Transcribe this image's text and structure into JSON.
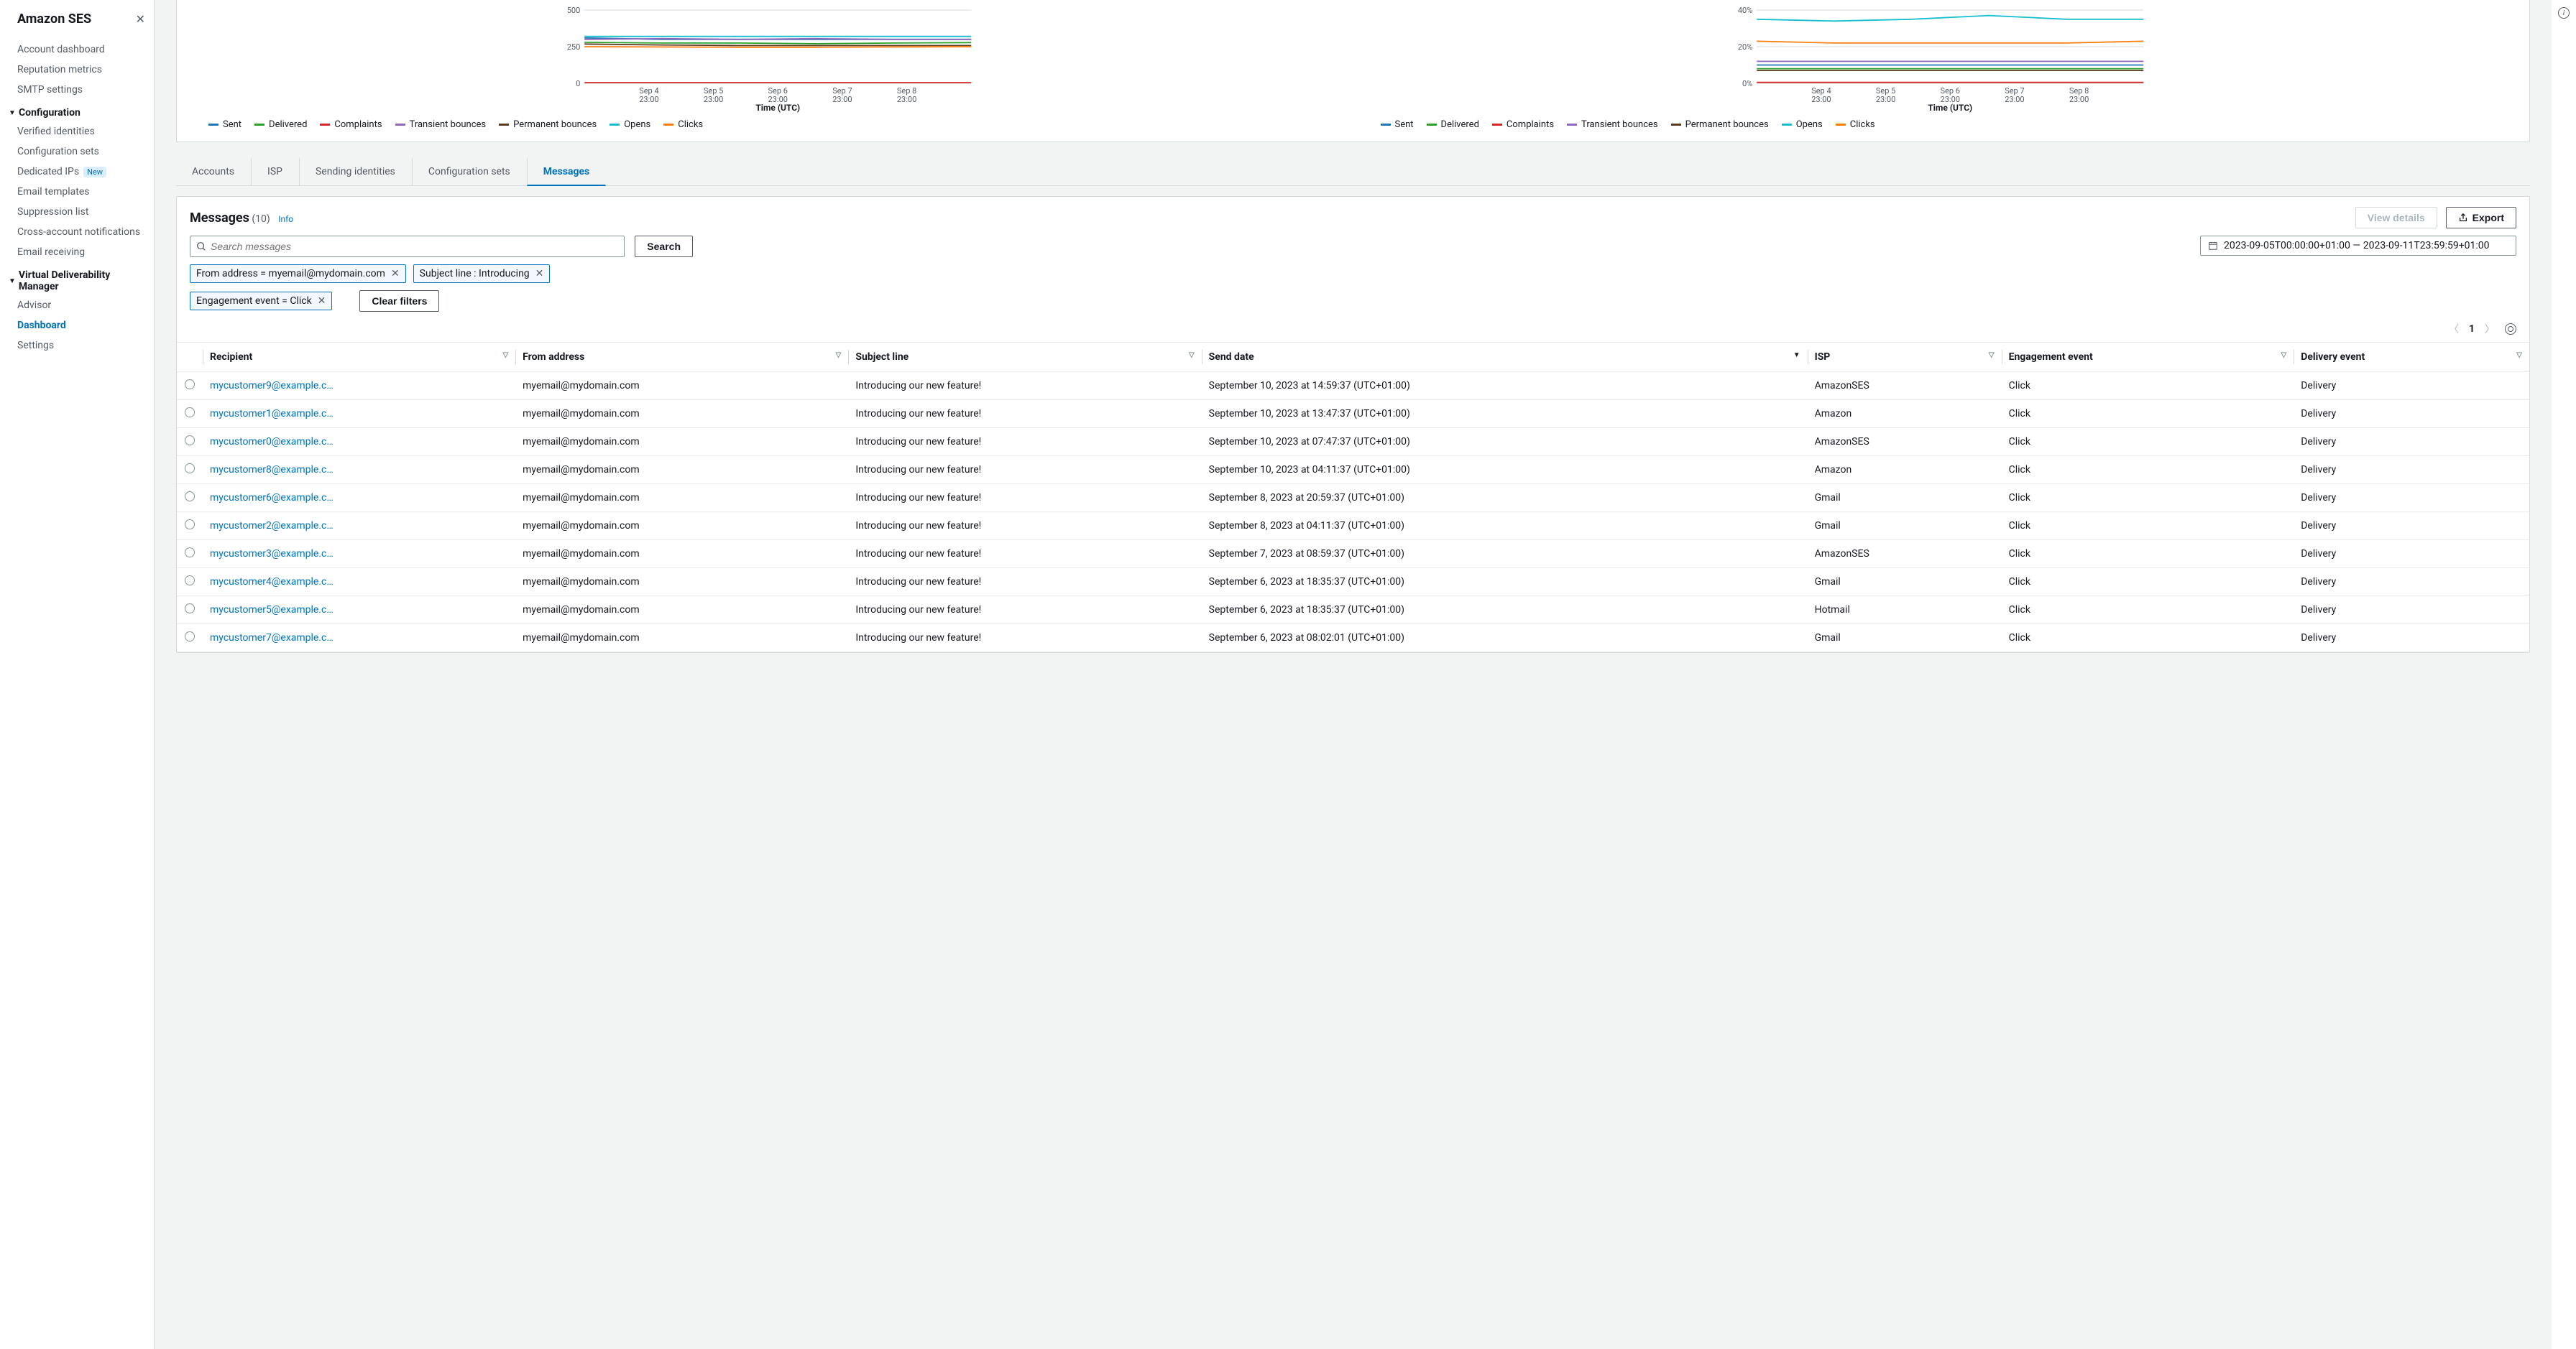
{
  "sidebar": {
    "title": "Amazon SES",
    "top_items": [
      "Account dashboard",
      "Reputation metrics",
      "SMTP settings"
    ],
    "sections": [
      {
        "label": "Configuration",
        "items": [
          {
            "label": "Verified identities"
          },
          {
            "label": "Configuration sets"
          },
          {
            "label": "Dedicated IPs",
            "badge": "New"
          },
          {
            "label": "Email templates"
          },
          {
            "label": "Suppression list"
          },
          {
            "label": "Cross-account notifications"
          },
          {
            "label": "Email receiving"
          }
        ]
      },
      {
        "label": "Virtual Deliverability Manager",
        "items": [
          {
            "label": "Advisor"
          },
          {
            "label": "Dashboard",
            "active": true
          },
          {
            "label": "Settings"
          }
        ]
      }
    ]
  },
  "legend_series": [
    {
      "name": "Sent",
      "color": "#1f77b4"
    },
    {
      "name": "Delivered",
      "color": "#2ca02c"
    },
    {
      "name": "Complaints",
      "color": "#d62728"
    },
    {
      "name": "Transient bounces",
      "color": "#9467bd"
    },
    {
      "name": "Permanent bounces",
      "color": "#5b3a1e"
    },
    {
      "name": "Opens",
      "color": "#17becf"
    },
    {
      "name": "Clicks",
      "color": "#ff7f0e"
    }
  ],
  "chart_data": [
    {
      "type": "line",
      "xlabel": "Time (UTC)",
      "categories": [
        "Sep 4 23:00",
        "Sep 5 23:00",
        "Sep 6 23:00",
        "Sep 7 23:00",
        "Sep 8 23:00"
      ],
      "ylim": [
        0,
        500
      ],
      "yticks": [
        0,
        250,
        500
      ],
      "series": [
        {
          "name": "Sent",
          "color": "#1f77b4",
          "values": [
            310,
            300,
            300,
            300,
            300,
            300
          ]
        },
        {
          "name": "Delivered",
          "color": "#2ca02c",
          "values": [
            280,
            275,
            275,
            270,
            275,
            278
          ]
        },
        {
          "name": "Complaints",
          "color": "#d62728",
          "values": [
            5,
            5,
            5,
            5,
            5,
            5
          ]
        },
        {
          "name": "Transient bounces",
          "color": "#9467bd",
          "values": [
            300,
            305,
            300,
            305,
            300,
            300
          ]
        },
        {
          "name": "Permanent bounces",
          "color": "#5b3a1e",
          "values": [
            268,
            262,
            258,
            258,
            258,
            258
          ]
        },
        {
          "name": "Opens",
          "color": "#17becf",
          "values": [
            320,
            320,
            320,
            320,
            320,
            320
          ]
        },
        {
          "name": "Clicks",
          "color": "#ff7f0e",
          "values": [
            250,
            248,
            246,
            246,
            248,
            250
          ]
        }
      ]
    },
    {
      "type": "line",
      "xlabel": "Time (UTC)",
      "categories": [
        "Sep 4 23:00",
        "Sep 5 23:00",
        "Sep 6 23:00",
        "Sep 7 23:00",
        "Sep 8 23:00"
      ],
      "ylim": [
        0,
        40
      ],
      "yticks": [
        0,
        20,
        40
      ],
      "yfmt": "%",
      "series": [
        {
          "name": "Sent",
          "color": "#1f77b4",
          "values": [
            10,
            10,
            10,
            10,
            10,
            10
          ]
        },
        {
          "name": "Delivered",
          "color": "#2ca02c",
          "values": [
            8,
            8,
            8,
            8,
            8,
            8
          ]
        },
        {
          "name": "Complaints",
          "color": "#d62728",
          "values": [
            0.5,
            0.5,
            0.5,
            0.5,
            0.5,
            0.5
          ]
        },
        {
          "name": "Transient bounces",
          "color": "#9467bd",
          "values": [
            12,
            12,
            12,
            12,
            12,
            12
          ]
        },
        {
          "name": "Permanent bounces",
          "color": "#5b3a1e",
          "values": [
            7,
            7,
            7,
            7,
            7,
            7
          ]
        },
        {
          "name": "Opens",
          "color": "#17becf",
          "values": [
            35,
            34,
            35,
            37,
            35,
            35
          ]
        },
        {
          "name": "Clicks",
          "color": "#ff7f0e",
          "values": [
            23,
            22,
            22,
            22,
            22,
            23
          ]
        }
      ]
    }
  ],
  "tabs": [
    "Accounts",
    "ISP",
    "Sending identities",
    "Configuration sets",
    "Messages"
  ],
  "active_tab": "Messages",
  "messages": {
    "title": "Messages",
    "count_label": "(10)",
    "info": "Info",
    "view_details": "View details",
    "export": "Export",
    "search_placeholder": "Search messages",
    "search_button": "Search",
    "date_range": "2023-09-05T00:00:00+01:00 — 2023-09-11T23:59:59+01:00",
    "tokens": [
      "From address = myemail@mydomain.com",
      "Subject line : Introducing",
      "Engagement event = Click"
    ],
    "clear_filters": "Clear filters",
    "page": "1",
    "columns": [
      "Recipient",
      "From address",
      "Subject line",
      "Send date",
      "ISP",
      "Engagement event",
      "Delivery event"
    ],
    "sort_col": "Send date",
    "rows": [
      {
        "recipient": "mycustomer9@example.c…",
        "from": "myemail@mydomain.com",
        "subject": "Introducing our new feature!",
        "send": "September 10, 2023 at 14:59:37 (UTC+01:00)",
        "isp": "AmazonSES",
        "eng": "Click",
        "del": "Delivery"
      },
      {
        "recipient": "mycustomer1@example.c…",
        "from": "myemail@mydomain.com",
        "subject": "Introducing our new feature!",
        "send": "September 10, 2023 at 13:47:37 (UTC+01:00)",
        "isp": "Amazon",
        "eng": "Click",
        "del": "Delivery"
      },
      {
        "recipient": "mycustomer0@example.c…",
        "from": "myemail@mydomain.com",
        "subject": "Introducing our new feature!",
        "send": "September 10, 2023 at 07:47:37 (UTC+01:00)",
        "isp": "AmazonSES",
        "eng": "Click",
        "del": "Delivery"
      },
      {
        "recipient": "mycustomer8@example.c…",
        "from": "myemail@mydomain.com",
        "subject": "Introducing our new feature!",
        "send": "September 10, 2023 at 04:11:37 (UTC+01:00)",
        "isp": "Amazon",
        "eng": "Click",
        "del": "Delivery"
      },
      {
        "recipient": "mycustomer6@example.c…",
        "from": "myemail@mydomain.com",
        "subject": "Introducing our new feature!",
        "send": "September 8, 2023 at 20:59:37 (UTC+01:00)",
        "isp": "Gmail",
        "eng": "Click",
        "del": "Delivery"
      },
      {
        "recipient": "mycustomer2@example.c…",
        "from": "myemail@mydomain.com",
        "subject": "Introducing our new feature!",
        "send": "September 8, 2023 at 04:11:37 (UTC+01:00)",
        "isp": "Gmail",
        "eng": "Click",
        "del": "Delivery"
      },
      {
        "recipient": "mycustomer3@example.c…",
        "from": "myemail@mydomain.com",
        "subject": "Introducing our new feature!",
        "send": "September 7, 2023 at 08:59:37 (UTC+01:00)",
        "isp": "AmazonSES",
        "eng": "Click",
        "del": "Delivery"
      },
      {
        "recipient": "mycustomer4@example.c…",
        "from": "myemail@mydomain.com",
        "subject": "Introducing our new feature!",
        "send": "September 6, 2023 at 18:35:37 (UTC+01:00)",
        "isp": "Gmail",
        "eng": "Click",
        "del": "Delivery"
      },
      {
        "recipient": "mycustomer5@example.c…",
        "from": "myemail@mydomain.com",
        "subject": "Introducing our new feature!",
        "send": "September 6, 2023 at 18:35:37 (UTC+01:00)",
        "isp": "Hotmail",
        "eng": "Click",
        "del": "Delivery"
      },
      {
        "recipient": "mycustomer7@example.c…",
        "from": "myemail@mydomain.com",
        "subject": "Introducing our new feature!",
        "send": "September 6, 2023 at 08:02:01 (UTC+01:00)",
        "isp": "Gmail",
        "eng": "Click",
        "del": "Delivery"
      }
    ]
  }
}
